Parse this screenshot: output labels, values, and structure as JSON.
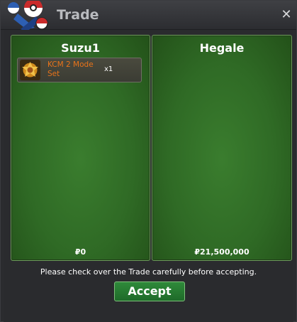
{
  "window": {
    "title": "Trade"
  },
  "left_panel": {
    "player_name": "Suzu1",
    "money": "0",
    "items": [
      {
        "name": "KCM 2 Mode Set",
        "quantity": "x1",
        "icon": "kcm-mode-set-icon"
      }
    ]
  },
  "right_panel": {
    "player_name": "Hegale",
    "money": "21,500,000"
  },
  "currency_symbol": "₽",
  "notice": "Please check over the Trade carefully before accepting.",
  "accept_label": "Accept",
  "colors": {
    "panel_green": "#2f6a25",
    "accept_green": "#1e6a29",
    "item_name": "#e8731a"
  }
}
